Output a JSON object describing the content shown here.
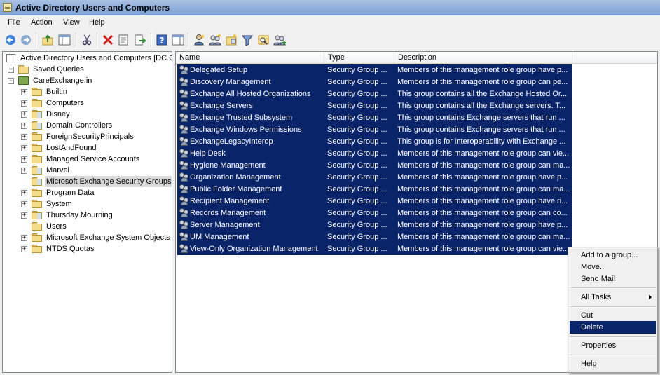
{
  "window": {
    "title": "Active Directory Users and Computers"
  },
  "menu": [
    "File",
    "Action",
    "View",
    "Help"
  ],
  "toolbar": {
    "icons": [
      "back-icon",
      "forward-icon",
      "up-level-icon",
      "show-hide-console-tree-icon",
      "cut-icon",
      "delete-icon",
      "properties-icon",
      "export-list-icon",
      "help-icon",
      "show-action-pane-icon",
      "new-user-icon",
      "new-group-icon",
      "new-ou-icon",
      "filter-icon",
      "find-icon",
      "add-to-group-icon"
    ]
  },
  "tree": {
    "root": "Active Directory Users and Computers [DC.C",
    "items": [
      {
        "label": "Saved Queries",
        "expander": "+",
        "icon": "folder"
      },
      {
        "label": "CareExchange.in",
        "expander": "-",
        "icon": "domain"
      },
      {
        "label": "Builtin",
        "expander": "+",
        "icon": "folder"
      },
      {
        "label": "Computers",
        "expander": "+",
        "icon": "folder"
      },
      {
        "label": "Disney",
        "expander": "+",
        "icon": "ou"
      },
      {
        "label": "Domain Controllers",
        "expander": "+",
        "icon": "ou"
      },
      {
        "label": "ForeignSecurityPrincipals",
        "expander": "+",
        "icon": "folder"
      },
      {
        "label": "LostAndFound",
        "expander": "+",
        "icon": "folder"
      },
      {
        "label": "Managed Service Accounts",
        "expander": "+",
        "icon": "folder"
      },
      {
        "label": "Marvel",
        "expander": "+",
        "icon": "ou"
      },
      {
        "label": "Microsoft Exchange Security Groups",
        "expander": "",
        "icon": "ou",
        "selected": true
      },
      {
        "label": "Program Data",
        "expander": "+",
        "icon": "folder"
      },
      {
        "label": "System",
        "expander": "+",
        "icon": "folder"
      },
      {
        "label": "Thursday Mourning",
        "expander": "+",
        "icon": "ou"
      },
      {
        "label": "Users",
        "expander": "",
        "icon": "folder"
      },
      {
        "label": "Microsoft Exchange System Objects",
        "expander": "+",
        "icon": "folder"
      },
      {
        "label": "NTDS Quotas",
        "expander": "+",
        "icon": "folder"
      }
    ]
  },
  "columns": [
    "Name",
    "Type",
    "Description"
  ],
  "rows": [
    {
      "name": "Delegated Setup",
      "type": "Security Group ...",
      "desc": "Members of this management role group have p..."
    },
    {
      "name": "Discovery Management",
      "type": "Security Group ...",
      "desc": "Members of this management role group can pe..."
    },
    {
      "name": "Exchange All Hosted Organizations",
      "type": "Security Group ...",
      "desc": "This group contains all the Exchange Hosted Or..."
    },
    {
      "name": "Exchange Servers",
      "type": "Security Group ...",
      "desc": "This group contains all the Exchange servers. T..."
    },
    {
      "name": "Exchange Trusted Subsystem",
      "type": "Security Group ...",
      "desc": "This group contains Exchange servers that run ..."
    },
    {
      "name": "Exchange Windows Permissions",
      "type": "Security Group ...",
      "desc": "This group contains Exchange servers that run ..."
    },
    {
      "name": "ExchangeLegacyInterop",
      "type": "Security Group ...",
      "desc": "This group is for interoperability with Exchange ..."
    },
    {
      "name": "Help Desk",
      "type": "Security Group ...",
      "desc": "Members of this management role group can vie..."
    },
    {
      "name": "Hygiene Management",
      "type": "Security Group ...",
      "desc": "Members of this management role group can ma..."
    },
    {
      "name": "Organization Management",
      "type": "Security Group ...",
      "desc": "Members of this management role group have p..."
    },
    {
      "name": "Public Folder Management",
      "type": "Security Group ...",
      "desc": "Members of this management role group can ma..."
    },
    {
      "name": "Recipient Management",
      "type": "Security Group ...",
      "desc": "Members of this management role group have ri..."
    },
    {
      "name": "Records Management",
      "type": "Security Group ...",
      "desc": "Members of this management role group can co..."
    },
    {
      "name": "Server Management",
      "type": "Security Group ...",
      "desc": "Members of this management role group have p..."
    },
    {
      "name": "UM Management",
      "type": "Security Group ...",
      "desc": "Members of this management role group can ma..."
    },
    {
      "name": "View-Only Organization Management",
      "type": "Security Group ...",
      "desc": "Members of this management role group can vie..."
    }
  ],
  "context_menu": {
    "add_to_group": "Add to a group...",
    "move": "Move...",
    "send_mail": "Send Mail",
    "all_tasks": "All Tasks",
    "cut": "Cut",
    "delete": "Delete",
    "properties": "Properties",
    "help": "Help"
  },
  "colors": {
    "selection": "#0a246a",
    "title_gradient_top": "#a9c2e4",
    "title_gradient_bottom": "#7b9fd2"
  }
}
